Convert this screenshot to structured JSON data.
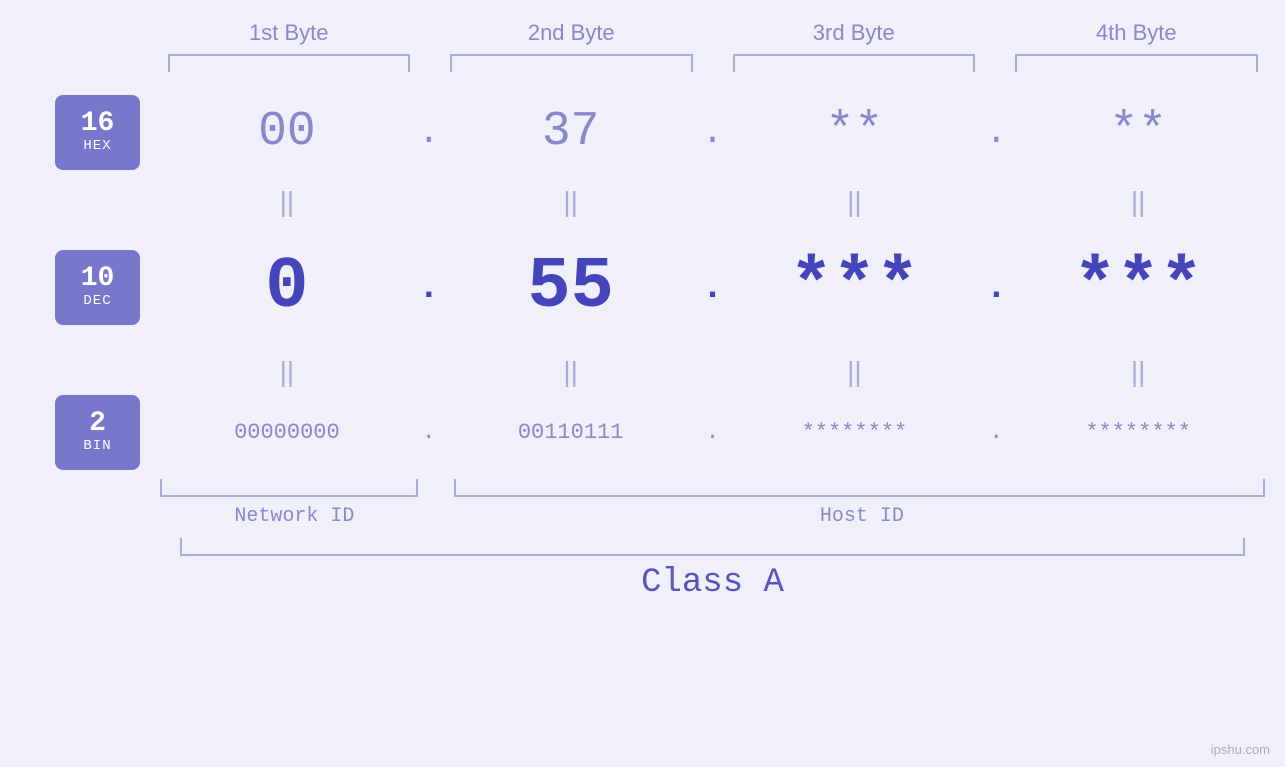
{
  "headers": {
    "byte1": "1st Byte",
    "byte2": "2nd Byte",
    "byte3": "3rd Byte",
    "byte4": "4th Byte"
  },
  "badges": {
    "hex": {
      "num": "16",
      "label": "HEX"
    },
    "dec": {
      "num": "10",
      "label": "DEC"
    },
    "bin": {
      "num": "2",
      "label": "BIN"
    }
  },
  "hex_row": {
    "b1": "00",
    "b2": "37",
    "b3": "**",
    "b4": "**",
    "d1": ".",
    "d2": ".",
    "d3": ".",
    "d4": "."
  },
  "dec_row": {
    "b1": "0",
    "b2": "55",
    "b3": "***",
    "b4": "***",
    "d1": ".",
    "d2": ".",
    "d3": ".",
    "d4": "."
  },
  "bin_row": {
    "b1": "00000000",
    "b2": "00110111",
    "b3": "********",
    "b4": "********",
    "d1": ".",
    "d2": ".",
    "d3": ".",
    "d4": "."
  },
  "labels": {
    "network_id": "Network ID",
    "host_id": "Host ID",
    "class": "Class A"
  },
  "equals": "||",
  "watermark": "ipshu.com"
}
